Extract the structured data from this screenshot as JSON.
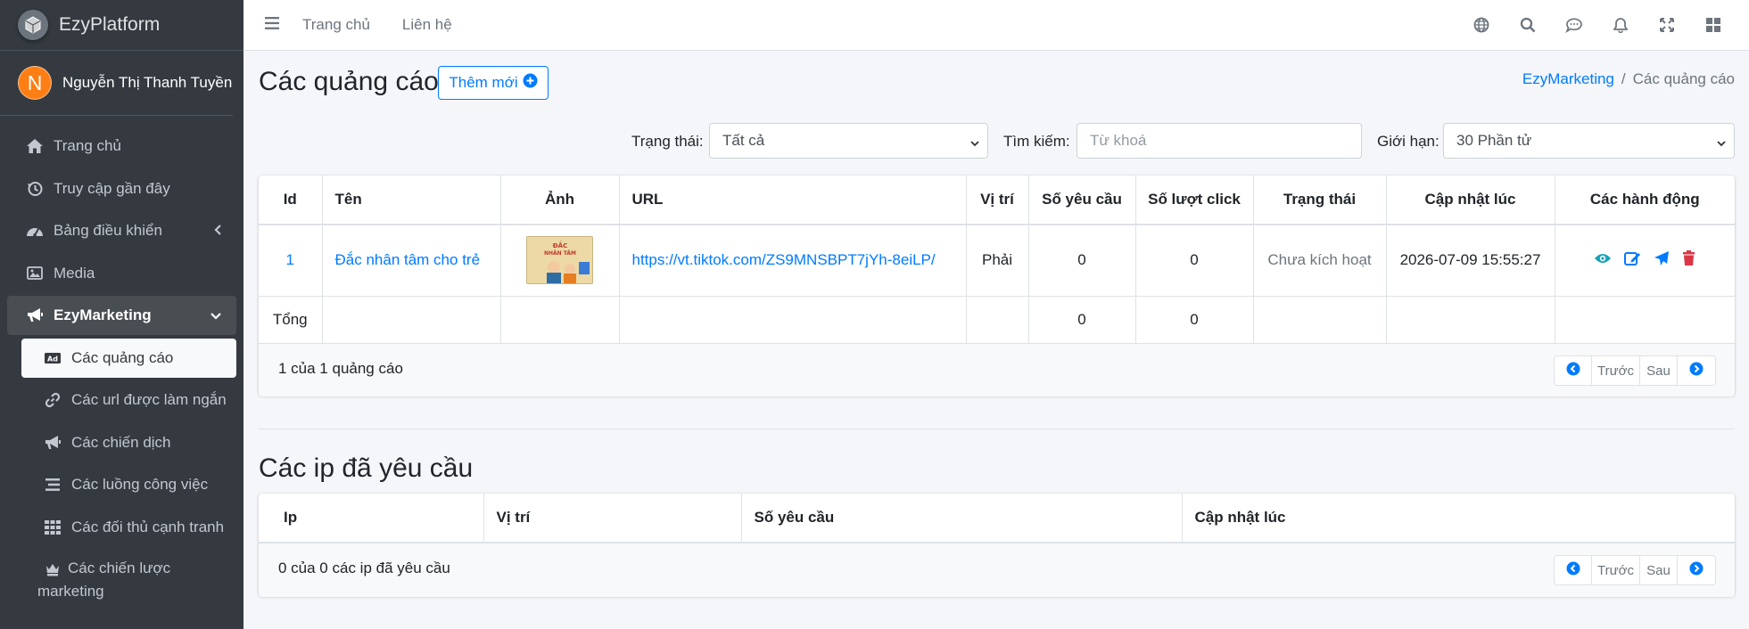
{
  "brand": {
    "name": "EzyPlatform"
  },
  "user": {
    "initial": "N",
    "name": "Nguyễn Thị Thanh Tuyền"
  },
  "sidebar": {
    "items": [
      {
        "label": "Trang chủ",
        "icon": "home-icon"
      },
      {
        "label": "Truy cập gần đây",
        "icon": "history-icon"
      },
      {
        "label": "Bảng điều khiển",
        "icon": "dashboard-icon"
      },
      {
        "label": "Media",
        "icon": "image-icon"
      },
      {
        "label": "EzyMarketing",
        "icon": "megaphone-icon"
      }
    ],
    "sub_items": [
      {
        "label": "Các quảng cáo",
        "icon": "ad-icon"
      },
      {
        "label": "Các url được làm ngắn",
        "icon": "link-icon"
      },
      {
        "label": "Các chiến dịch",
        "icon": "megaphone-icon"
      },
      {
        "label": "Các luồng công việc",
        "icon": "list-icon"
      },
      {
        "label": "Các đối thủ cạnh tranh",
        "icon": "grid-icon"
      },
      {
        "label": "Các chiến lược marketing",
        "icon": "chess-icon"
      }
    ]
  },
  "topbar": {
    "links": [
      "Trang chủ",
      "Liên hệ"
    ]
  },
  "page": {
    "title": "Các quảng cáo",
    "add_button": "Thêm mới",
    "breadcrumb": [
      "EzyMarketing",
      "Các quảng cáo"
    ]
  },
  "filters": {
    "status_label": "Trạng thái:",
    "status_value": "Tất cả",
    "search_label": "Tìm kiếm:",
    "search_placeholder": "Từ khoá",
    "limit_label": "Giới hạn:",
    "limit_value": "30 Phần tử"
  },
  "ads_table": {
    "headers": [
      "Id",
      "Tên",
      "Ảnh",
      "URL",
      "Vị trí",
      "Số yêu cầu",
      "Số lượt click",
      "Trạng thái",
      "Cập nhật lúc",
      "Các hành động"
    ],
    "rows": [
      {
        "id": "1",
        "name": "Đắc nhân tâm cho trẻ",
        "url": "https://vt.tiktok.com/ZS9MNSBPT7jYh-8eiLP/",
        "position": "Phải",
        "requests": "0",
        "clicks": "0",
        "status": "Chưa kích hoạt",
        "updated": "2026-07-09 15:55:27"
      }
    ],
    "total": {
      "label": "Tổng",
      "requests": "0",
      "clicks": "0"
    },
    "footer_count": "1 của 1 quảng cáo"
  },
  "pager": {
    "prev": "Trước",
    "next": "Sau"
  },
  "ips_section": {
    "title": "Các ip đã yêu cầu",
    "headers": [
      "Ip",
      "Vị trí",
      "Số yêu cầu",
      "Cập nhật lúc"
    ],
    "footer_count": "0 của 0 các ip đã yêu cầu"
  },
  "colors": {
    "primary": "#007bff",
    "sidebar": "#343a40",
    "danger": "#dc3545",
    "info": "#17a2b8",
    "avatar": "#fd7e14"
  }
}
